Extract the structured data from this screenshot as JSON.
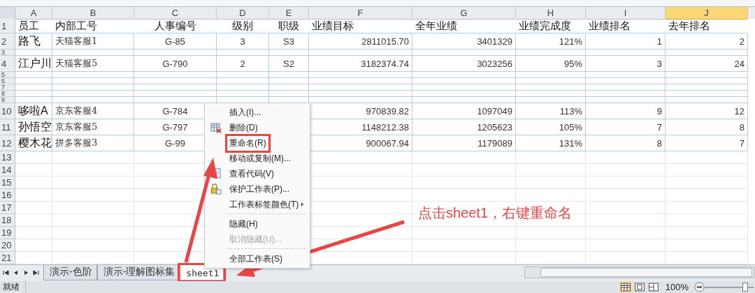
{
  "columns": [
    {
      "letter": "A",
      "selected": false
    },
    {
      "letter": "B",
      "selected": false
    },
    {
      "letter": "C",
      "selected": false
    },
    {
      "letter": "D",
      "selected": false
    },
    {
      "letter": "E",
      "selected": false
    },
    {
      "letter": "F",
      "selected": false
    },
    {
      "letter": "G",
      "selected": false
    },
    {
      "letter": "H",
      "selected": false
    },
    {
      "letter": "I",
      "selected": false
    },
    {
      "letter": "J",
      "selected": true
    }
  ],
  "rows": [
    {
      "number": "1",
      "kind": "header",
      "cells": [
        "员工",
        "内部工号",
        "人事编号",
        "级别",
        "职级",
        "业绩目标",
        "全年业绩",
        "业绩完成度",
        "业绩排名",
        "去年排名"
      ]
    },
    {
      "number": "2",
      "kind": "normal",
      "cells": [
        "路飞",
        "天猫客服1",
        "G-85",
        "3",
        "S3",
        "2811015.70",
        "3401329",
        "121%",
        "1",
        "2"
      ]
    },
    {
      "number": "3",
      "kind": "squished",
      "cells": []
    },
    {
      "number": "4",
      "kind": "normal",
      "cells": [
        "江户川",
        "天猫客服5",
        "G-790",
        "2",
        "S2",
        "3182374.74",
        "3023256",
        "95%",
        "3",
        "24"
      ]
    },
    {
      "number": "5",
      "kind": "squished",
      "cells": []
    },
    {
      "number": "6",
      "kind": "squished",
      "cells": []
    },
    {
      "number": "7",
      "kind": "squished",
      "cells": []
    },
    {
      "number": "8",
      "kind": "squished",
      "cells": []
    },
    {
      "number": "9",
      "kind": "squished",
      "cells": []
    },
    {
      "number": "10",
      "kind": "normal",
      "cells": [
        "哆啦A",
        "京东客服4",
        "G-784",
        "",
        "",
        "970839.82",
        "1097049",
        "113%",
        "9",
        "12"
      ]
    },
    {
      "number": "11",
      "kind": "normal",
      "cells": [
        "孙悟空",
        "京东客服5",
        "G-797",
        "",
        "",
        "1148212.38",
        "1205623",
        "105%",
        "7",
        "8"
      ]
    },
    {
      "number": "12",
      "kind": "normal",
      "cells": [
        "樱木花",
        "拼多客服3",
        "G-99",
        "",
        "",
        "900067.94",
        "1179089",
        "131%",
        "8",
        "7"
      ]
    },
    {
      "number": "13",
      "kind": "empty",
      "cells": []
    },
    {
      "number": "14",
      "kind": "empty",
      "cells": []
    },
    {
      "number": "15",
      "kind": "empty",
      "cells": []
    },
    {
      "number": "16",
      "kind": "empty",
      "cells": []
    },
    {
      "number": "17",
      "kind": "empty",
      "cells": []
    },
    {
      "number": "18",
      "kind": "empty",
      "cells": []
    },
    {
      "number": "19",
      "kind": "empty",
      "cells": []
    },
    {
      "number": "20",
      "kind": "empty",
      "cells": []
    },
    {
      "number": "21",
      "kind": "empty",
      "cells": []
    }
  ],
  "context_menu": [
    {
      "kind": "plain",
      "label": "插入(I)...",
      "disabled": false,
      "submenu": false,
      "boxed": false
    },
    {
      "kind": "delete",
      "label": "删除(D)",
      "disabled": false,
      "submenu": false,
      "boxed": false
    },
    {
      "kind": "plain",
      "label": "重命名(R)",
      "disabled": false,
      "submenu": false,
      "boxed": true
    },
    {
      "kind": "plain",
      "label": "移动或复制(M)...",
      "disabled": false,
      "submenu": false,
      "boxed": false
    },
    {
      "kind": "code",
      "label": "查看代码(V)",
      "disabled": false,
      "submenu": false,
      "boxed": false
    },
    {
      "kind": "lock",
      "label": "保护工作表(P)...",
      "disabled": false,
      "submenu": false,
      "boxed": false
    },
    {
      "kind": "plain",
      "label": "工作表标签颜色(T)",
      "disabled": false,
      "submenu": true,
      "boxed": false
    },
    {
      "kind": "separator"
    },
    {
      "kind": "plain",
      "label": "隐藏(H)",
      "disabled": false,
      "submenu": false,
      "boxed": false
    },
    {
      "kind": "plain",
      "label": "取消隐藏(U)...",
      "disabled": true,
      "submenu": false,
      "boxed": false
    },
    {
      "kind": "separator"
    },
    {
      "kind": "plain",
      "label": "全部工作表(S)",
      "disabled": false,
      "submenu": false,
      "boxed": false
    }
  ],
  "sheet_tabs": [
    {
      "label": "演示-色阶",
      "selected": false,
      "boxed": false
    },
    {
      "label": "演示-理解图标集",
      "selected": false,
      "boxed": false
    },
    {
      "label": "sheet1",
      "selected": true,
      "boxed": true
    }
  ],
  "annotation": {
    "text": "点击sheet1，右键重命名"
  },
  "status_bar": {
    "status": "就绪",
    "zoom": "100%",
    "zoom_slider": {
      "level": 0.85
    }
  }
}
